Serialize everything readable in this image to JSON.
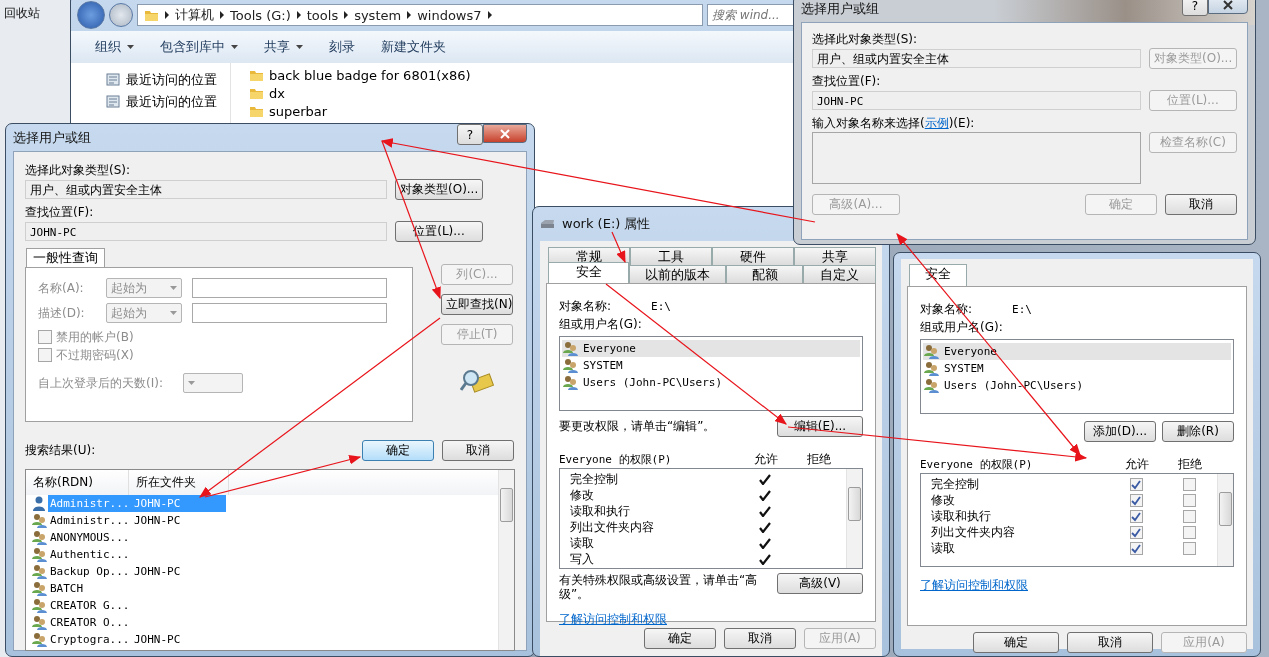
{
  "desktop": {
    "icons": [
      {
        "label": "回收站"
      }
    ]
  },
  "explorer": {
    "breadcrumbs": [
      "计算机",
      "Tools (G:)",
      "tools",
      "system",
      "windows7"
    ],
    "search": {
      "placeholder": "搜索 wind..."
    },
    "toolbar": [
      {
        "label": "组织",
        "dropdown": true
      },
      {
        "label": "包含到库中",
        "dropdown": true
      },
      {
        "label": "共享",
        "dropdown": true
      },
      {
        "label": "刻录",
        "dropdown": false
      },
      {
        "label": "新建文件夹",
        "dropdown": false
      }
    ],
    "nav_items": [
      "最近访问的位置",
      "最近访问的位置"
    ],
    "files": [
      "back blue badge for 6801(x86)",
      "dx",
      "superbar"
    ]
  },
  "select_dialog": {
    "title": "选择用户或组",
    "help": "?",
    "object_type_label": "选择此对象类型(S):",
    "object_type": "用户、组或内置安全主体",
    "object_type_button": "对象类型(O)...",
    "location_label": "查找位置(F):",
    "location": "JOHN-PC",
    "location_button": "位置(L)...",
    "query_tab": "一般性查询",
    "fields": [
      {
        "label": "名称(A):",
        "operator": "起始为"
      },
      {
        "label": "描述(D):",
        "operator": "起始为"
      }
    ],
    "checkboxes": [
      {
        "label": "禁用的帐户(B)",
        "checked": false
      },
      {
        "label": "不过期密码(X)",
        "checked": false
      }
    ],
    "days_label": "自上次登录后的天数(I):",
    "side_buttons": [
      {
        "label": "列(C)...",
        "disabled": true
      },
      {
        "label": "立即查找(N)",
        "disabled": false
      },
      {
        "label": "停止(T)",
        "disabled": true
      }
    ],
    "ok": "确定",
    "cancel": "取消",
    "results_label": "搜索结果(U):",
    "columns": [
      "名称(RDN)",
      "所在文件夹"
    ],
    "rows": [
      {
        "name": "Administr...",
        "folder": "JOHN-PC",
        "kind": "user",
        "selected": true
      },
      {
        "name": "Administr...",
        "folder": "JOHN-PC",
        "kind": "group",
        "selected": false
      },
      {
        "name": "ANONYMOUS...",
        "kind": "group",
        "selected": false
      },
      {
        "name": "Authentic...",
        "kind": "group",
        "selected": false
      },
      {
        "name": "Backup Op...",
        "folder": "JOHN-PC",
        "kind": "group",
        "selected": false
      },
      {
        "name": "BATCH",
        "kind": "group",
        "selected": false
      },
      {
        "name": "CREATOR G...",
        "kind": "group",
        "selected": false
      },
      {
        "name": "CREATOR O...",
        "kind": "group",
        "selected": false
      },
      {
        "name": "Cryptogra...",
        "folder": "JOHN-PC",
        "kind": "group",
        "selected": false
      }
    ]
  },
  "properties": {
    "title": "work (E:) 属性",
    "tab_rows": [
      [
        {
          "label": "常规",
          "selected": false
        },
        {
          "label": "工具",
          "selected": false
        },
        {
          "label": "硬件",
          "selected": false
        },
        {
          "label": "共享",
          "selected": false
        }
      ],
      [
        {
          "label": "安全",
          "selected": true
        },
        {
          "label": "以前的版本",
          "selected": false
        },
        {
          "label": "配额",
          "selected": false
        },
        {
          "label": "自定义",
          "selected": false
        }
      ]
    ],
    "object_name_label": "对象名称:",
    "object_name": "E:\\",
    "groups_label": "组或用户名(G):",
    "principals": [
      {
        "name": "Everyone",
        "selected": true
      },
      {
        "name": "SYSTEM",
        "selected": false
      },
      {
        "name": "Users (John-PC\\Users)",
        "selected": false
      }
    ],
    "edit_hint": "要更改权限，请单击“编辑”。",
    "edit_button": "编辑(E)...",
    "permissions_label": "Everyone 的权限(P)",
    "allow_label": "允许",
    "deny_label": "拒绝",
    "permissions": [
      {
        "name": "完全控制",
        "allow": true,
        "deny": false
      },
      {
        "name": "修改",
        "allow": true,
        "deny": false
      },
      {
        "name": "读取和执行",
        "allow": true,
        "deny": false
      },
      {
        "name": "列出文件夹内容",
        "allow": true,
        "deny": false
      },
      {
        "name": "读取",
        "allow": true,
        "deny": false
      },
      {
        "name": "写入",
        "allow": true,
        "deny": false
      }
    ],
    "advanced_hint": "有关特殊权限或高级设置，请单击“高级”。",
    "advanced_button": "高级(V)",
    "link": "了解访问控制和权限",
    "buttons": [
      {
        "label": "确定",
        "disabled": false
      },
      {
        "label": "取消",
        "disabled": false
      },
      {
        "label": "应用(A)",
        "disabled": true
      }
    ]
  },
  "select_dialog_2": {
    "title": "选择用户或组",
    "help": "?",
    "object_type_label": "选择此对象类型(S):",
    "object_type": "用户、组或内置安全主体",
    "object_type_button": "对象类型(O)...",
    "location_label": "查找位置(F):",
    "location": "JOHN-PC",
    "location_button": "位置(L)...",
    "names_label_before": "输入对象名称来选择(",
    "example_link": "示例",
    "names_label_after": ")(E):",
    "check_names_button": "检查名称(C)",
    "advanced_button": "高级(A)...",
    "buttons": [
      {
        "label": "确定",
        "disabled": true
      },
      {
        "label": "取消",
        "disabled": false
      }
    ]
  },
  "security_editor": {
    "tab": "安全",
    "object_name_label": "对象名称:",
    "object_name": "E:\\",
    "groups_label": "组或用户名(G):",
    "principals": [
      {
        "name": "Everyone",
        "selected": true
      },
      {
        "name": "SYSTEM",
        "selected": false
      },
      {
        "name": "Users (John-PC\\Users)",
        "selected": false
      }
    ],
    "add_button": "添加(D)...",
    "remove_button": "删除(R)",
    "permissions_label": "Everyone 的权限(P)",
    "allow_label": "允许",
    "deny_label": "拒绝",
    "permissions": [
      {
        "name": "完全控制",
        "allow": true,
        "deny": false
      },
      {
        "name": "修改",
        "allow": true,
        "deny": false
      },
      {
        "name": "读取和执行",
        "allow": true,
        "deny": false
      },
      {
        "name": "列出文件夹内容",
        "allow": true,
        "deny": false
      },
      {
        "name": "读取",
        "allow": true,
        "deny": false
      }
    ],
    "link": "了解访问控制和权限",
    "buttons": [
      {
        "label": "确定",
        "disabled": false
      },
      {
        "label": "取消",
        "disabled": false
      },
      {
        "label": "应用(A)",
        "disabled": true
      }
    ]
  }
}
